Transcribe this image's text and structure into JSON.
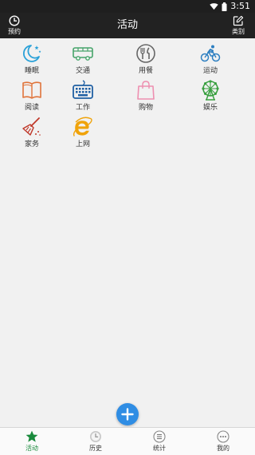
{
  "status": {
    "time": "3:51"
  },
  "appbar": {
    "title": "活动",
    "left_label": "预约",
    "right_label": "类别"
  },
  "activities": [
    {
      "label": "睡眠",
      "icon": "moon-stars-icon",
      "color": "#2aa1d8"
    },
    {
      "label": "交通",
      "icon": "bus-icon",
      "color": "#46a46a"
    },
    {
      "label": "用餐",
      "icon": "fork-knife-icon",
      "color": "#666666"
    },
    {
      "label": "运动",
      "icon": "cyclist-icon",
      "color": "#2d7fc1"
    },
    {
      "label": "阅读",
      "icon": "book-icon",
      "color": "#e0743b"
    },
    {
      "label": "工作",
      "icon": "keyboard-icon",
      "color": "#1f5fa3"
    },
    {
      "label": "购物",
      "icon": "shopping-bag-icon",
      "color": "#ee8fb0"
    },
    {
      "label": "娱乐",
      "icon": "ferris-wheel-icon",
      "color": "#3aa041"
    },
    {
      "label": "家务",
      "icon": "broom-icon",
      "color": "#c0392b"
    },
    {
      "label": "上网",
      "icon": "internet-explorer-icon",
      "color": "#f0a30a"
    }
  ],
  "bottom_nav": [
    {
      "label": "活动",
      "icon": "star-icon",
      "active": true
    },
    {
      "label": "历史",
      "icon": "history-clock-icon",
      "active": false
    },
    {
      "label": "统计",
      "icon": "list-icon",
      "active": false
    },
    {
      "label": "我的",
      "icon": "more-dots-icon",
      "active": false
    }
  ],
  "colors": {
    "accent_green": "#1a8a3c",
    "fab_blue": "#2f8de4",
    "bar_dark": "#222222"
  }
}
